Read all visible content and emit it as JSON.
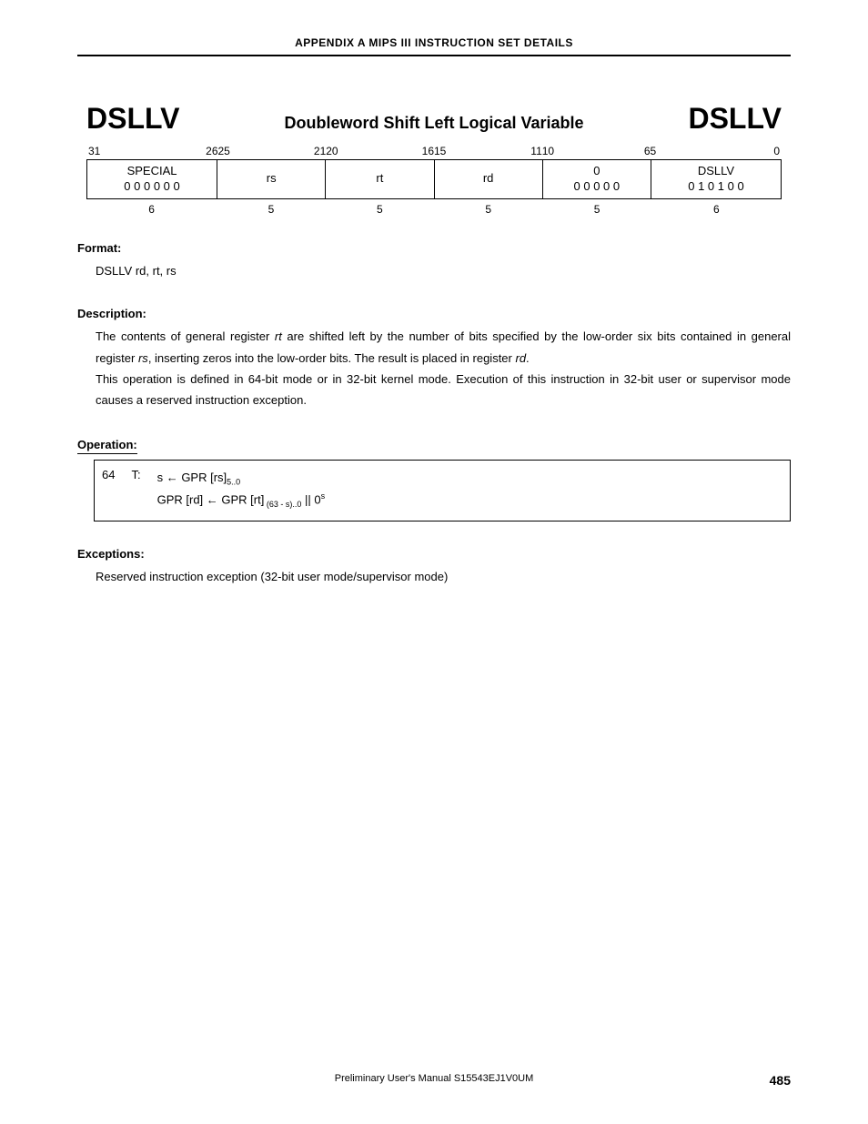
{
  "header": {
    "appendix": "APPENDIX A   MIPS III INSTRUCTION SET DETAILS"
  },
  "title": {
    "mnemonic_left": "DSLLV",
    "full_name": "Doubleword Shift Left Logical Variable",
    "mnemonic_right": "DSLLV"
  },
  "encoding": {
    "bits": [
      {
        "hi": "31",
        "lo": "26",
        "w": 6
      },
      {
        "hi": "25",
        "lo": "21",
        "w": 5
      },
      {
        "hi": "20",
        "lo": "16",
        "w": 5
      },
      {
        "hi": "15",
        "lo": "11",
        "w": 5
      },
      {
        "hi": "10",
        "lo": "6",
        "w": 5
      },
      {
        "hi": "5",
        "lo": "0",
        "w": 6
      }
    ],
    "fields": [
      {
        "line1": "SPECIAL",
        "line2": "0 0 0 0 0 0"
      },
      {
        "line1": "rs",
        "line2": ""
      },
      {
        "line1": "rt",
        "line2": ""
      },
      {
        "line1": "rd",
        "line2": ""
      },
      {
        "line1": "0",
        "line2": "0 0 0 0 0"
      },
      {
        "line1": "DSLLV",
        "line2": "0 1 0 1 0 0"
      }
    ],
    "widths": [
      "6",
      "5",
      "5",
      "5",
      "5",
      "6"
    ]
  },
  "format": {
    "label": "Format:",
    "text": "DSLLV rd, rt, rs"
  },
  "description": {
    "label": "Description:",
    "p1_a": "The contents of general register ",
    "p1_rt": "rt",
    "p1_b": " are shifted left by the number of bits specified by the low-order six bits contained in general register ",
    "p1_rs": "rs",
    "p1_c": ", inserting zeros into the low-order bits.  The result is placed in register ",
    "p1_rd": "rd",
    "p1_d": ".",
    "p2": "This operation is defined in 64-bit mode or in 32-bit kernel mode.  Execution of this instruction in 32-bit user or supervisor mode causes a reserved instruction exception."
  },
  "operation": {
    "label": "Operation:",
    "mode": "64",
    "t": "T:",
    "line1_a": "s ← GPR [rs]",
    "line1_sub": "5..0",
    "line2_a": "GPR [rd] ← GPR [rt]",
    "line2_sub": " (63 - s)..0",
    "line2_b": " || 0",
    "line2_sup": "s"
  },
  "exceptions": {
    "label": "Exceptions:",
    "text": "Reserved instruction exception (32-bit user mode/supervisor mode)"
  },
  "footer": {
    "center": "Preliminary User's Manual  S15543EJ1V0UM",
    "page": "485"
  }
}
